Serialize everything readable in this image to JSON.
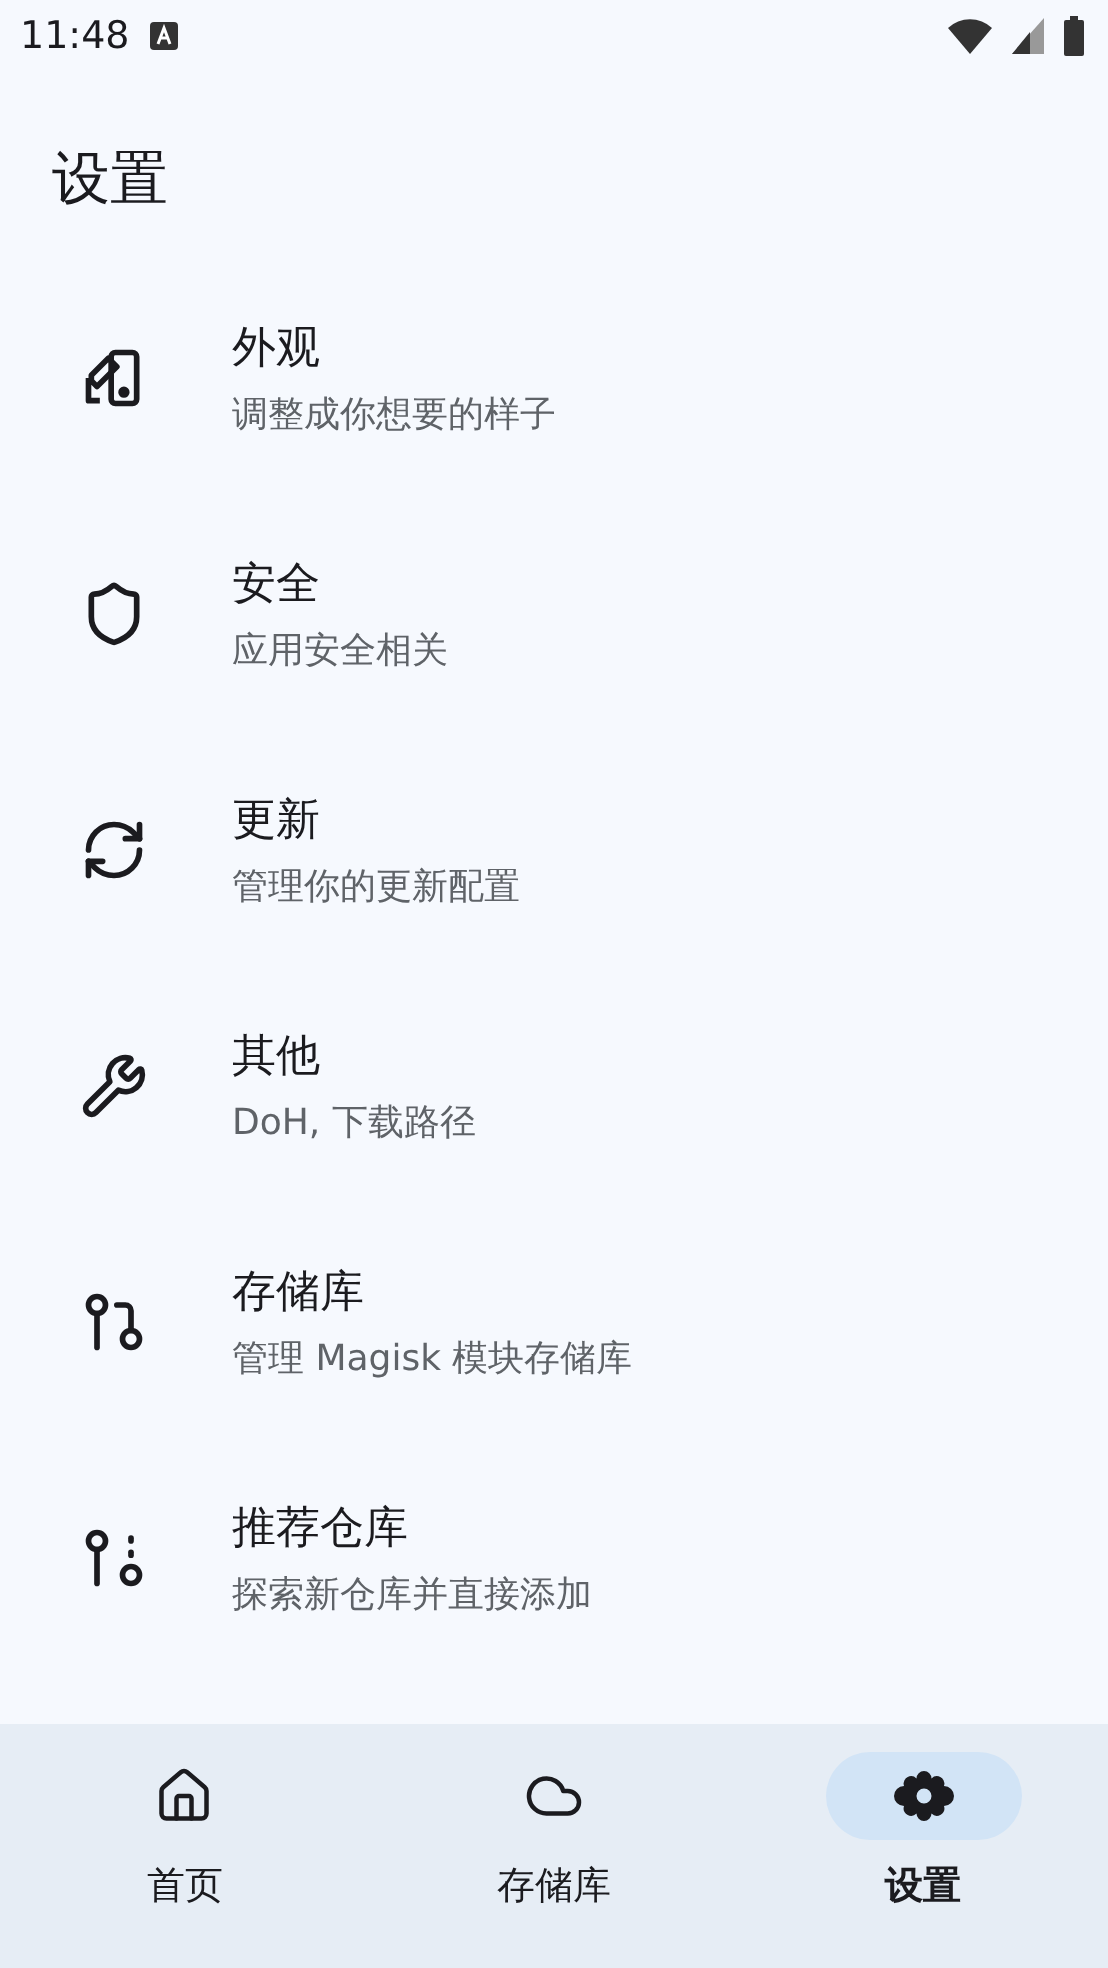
{
  "status_bar": {
    "time": "11:48"
  },
  "title": "设置",
  "items": [
    {
      "kind": "appearance",
      "title": "外观",
      "subtitle": "调整成你想要的样子"
    },
    {
      "kind": "security",
      "title": "安全",
      "subtitle": "应用安全相关"
    },
    {
      "kind": "update",
      "title": "更新",
      "subtitle": "管理你的更新配置"
    },
    {
      "kind": "other",
      "title": "其他",
      "subtitle": "DoH, 下载路径"
    },
    {
      "kind": "repository",
      "title": "存储库",
      "subtitle": "管理 Magisk 模块存储库"
    },
    {
      "kind": "recommended",
      "title": "推荐仓库",
      "subtitle": "探索新仓库并直接添加"
    }
  ],
  "nav": [
    {
      "kind": "home",
      "label": "首页",
      "selected": false
    },
    {
      "kind": "cloud",
      "label": "存储库",
      "selected": false
    },
    {
      "kind": "settings",
      "label": "设置",
      "selected": true
    }
  ]
}
